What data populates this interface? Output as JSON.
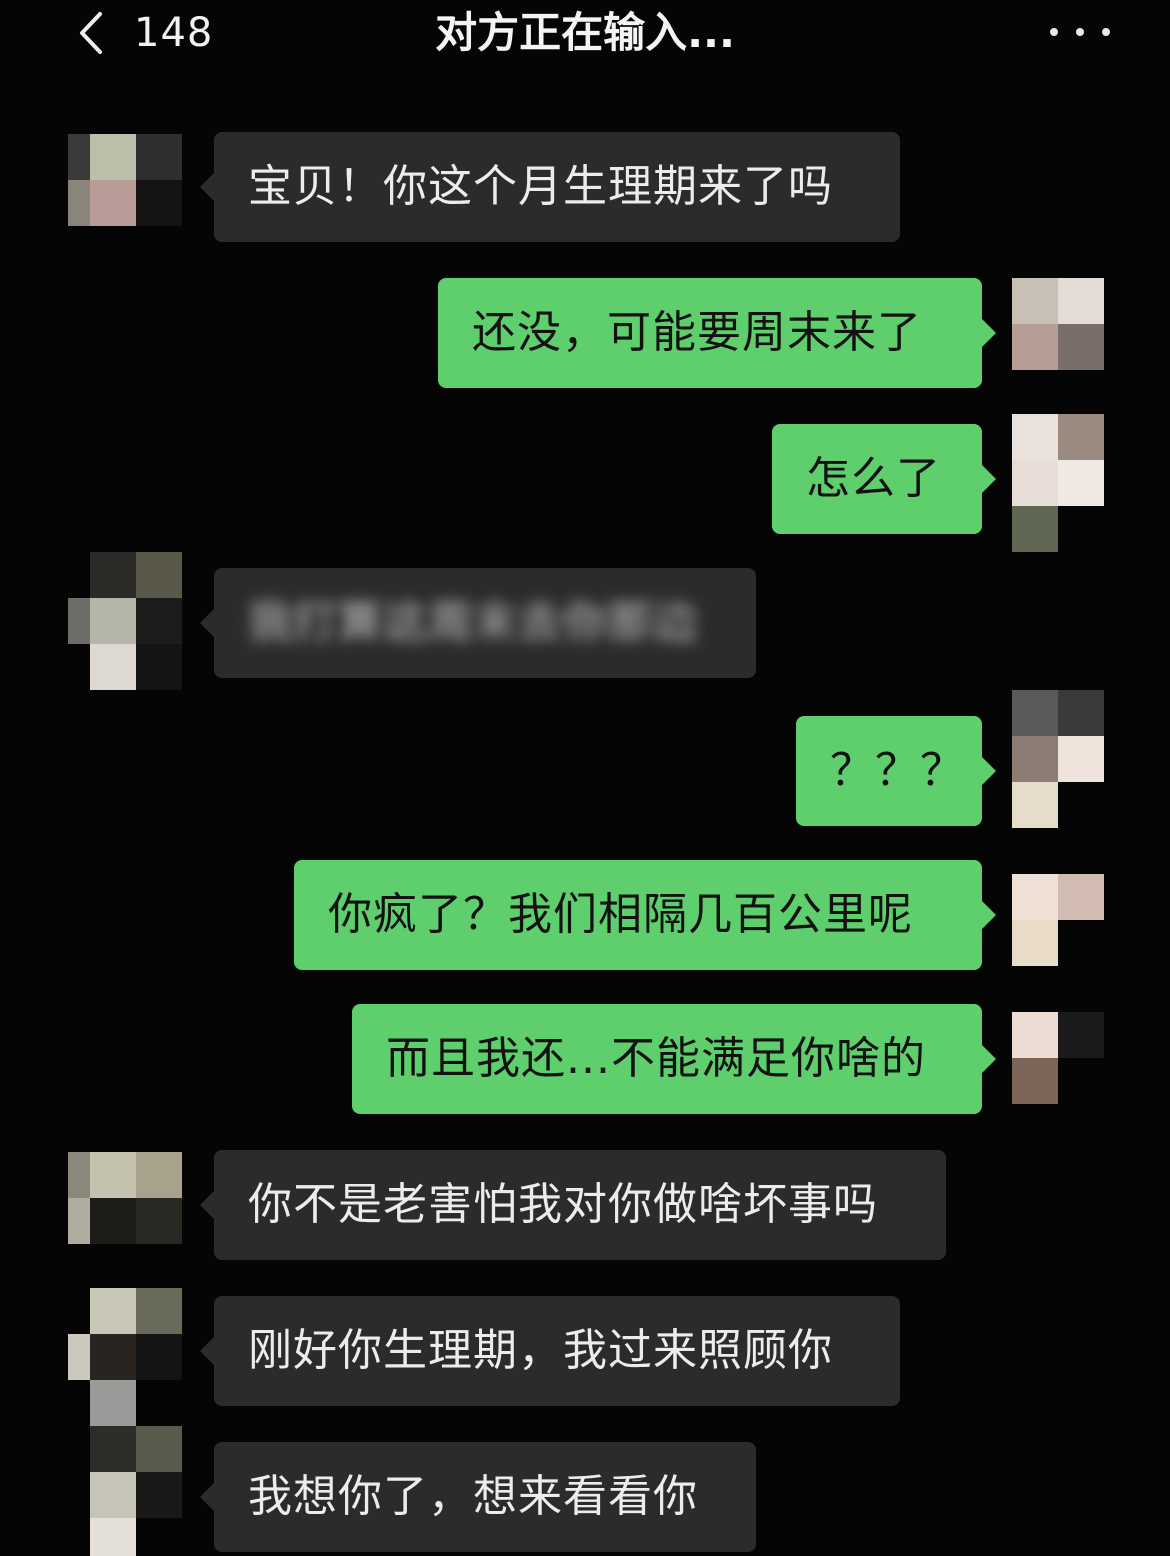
{
  "header": {
    "back_count": "148",
    "title": "对方正在输入...",
    "more_icon": "more-dots-icon"
  },
  "messages": [
    {
      "side": "in",
      "text": "宝贝！你这个月生理期来了吗"
    },
    {
      "side": "out",
      "text": "还没，可能要周末来了"
    },
    {
      "side": "out",
      "text": "怎么了"
    },
    {
      "side": "in",
      "text": "我打算这周末去你那边",
      "blurred": true
    },
    {
      "side": "out",
      "text": "？？？"
    },
    {
      "side": "out",
      "text": "你疯了？我们相隔几百公里呢"
    },
    {
      "side": "out",
      "text": "而且我还...不能满足你啥的"
    },
    {
      "side": "in",
      "text": "你不是老害怕我对你做啥坏事吗"
    },
    {
      "side": "in",
      "text": "刚好你生理期，我过来照顾你"
    },
    {
      "side": "in",
      "text": "我想你了，想来看看你"
    }
  ],
  "colors": {
    "background": "#050505",
    "incoming_bubble": "#2b2b2b",
    "outgoing_bubble": "#5fcf6e"
  }
}
